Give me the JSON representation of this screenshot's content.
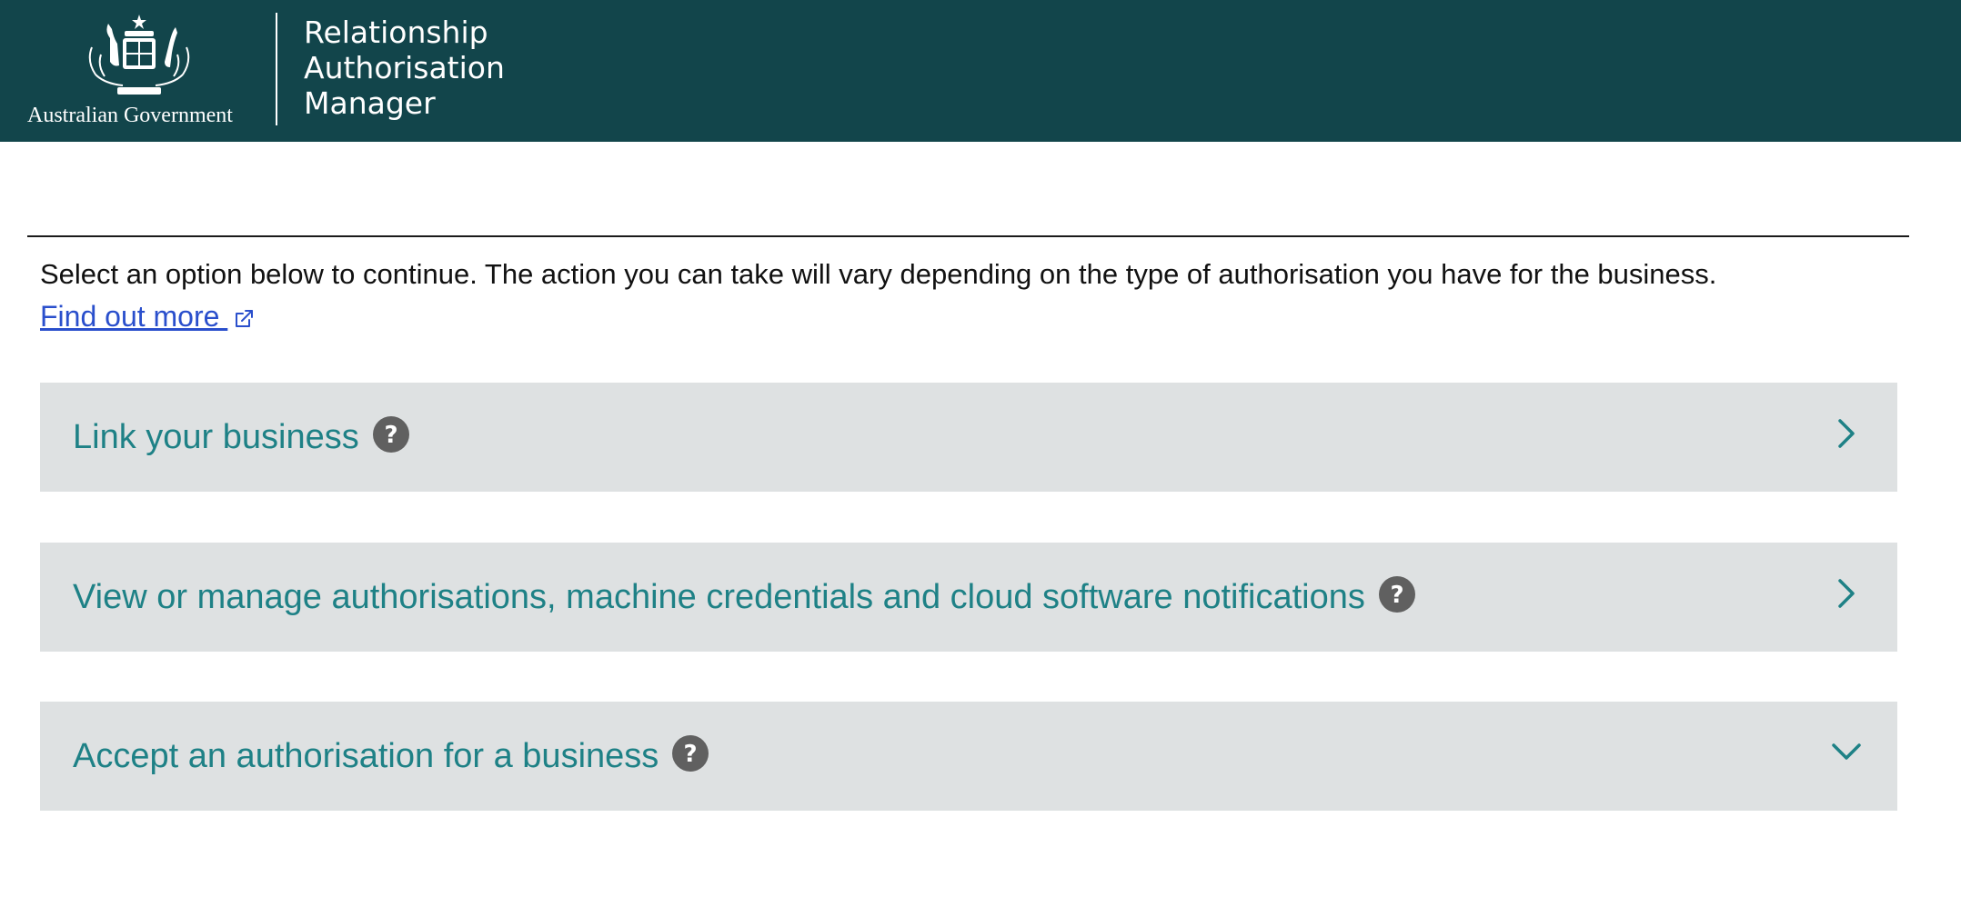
{
  "header": {
    "gov_name": "Australian Government",
    "app_title_lines": [
      "Relationship",
      "Authorisation",
      "Manager"
    ],
    "background_color": "#12454b"
  },
  "main": {
    "intro_text": "Select an option below to continue. The action you can take will vary depending on the type of authorisation you have for the business.",
    "find_out_more": {
      "label": "Find out more ",
      "icon": "external-link-icon"
    },
    "options": [
      {
        "label": "Link your business",
        "help_icon": "help-icon",
        "state_icon": "chevron-right-icon"
      },
      {
        "label": "View or manage authorisations, machine credentials and cloud software notifications",
        "help_icon": "help-icon",
        "state_icon": "chevron-right-icon"
      },
      {
        "label": "Accept an authorisation for a business",
        "help_icon": "help-icon",
        "state_icon": "chevron-down-icon"
      }
    ]
  },
  "colors": {
    "accent": "#1e8186",
    "link": "#2a4fcc",
    "option_background": "#dee1e2"
  }
}
